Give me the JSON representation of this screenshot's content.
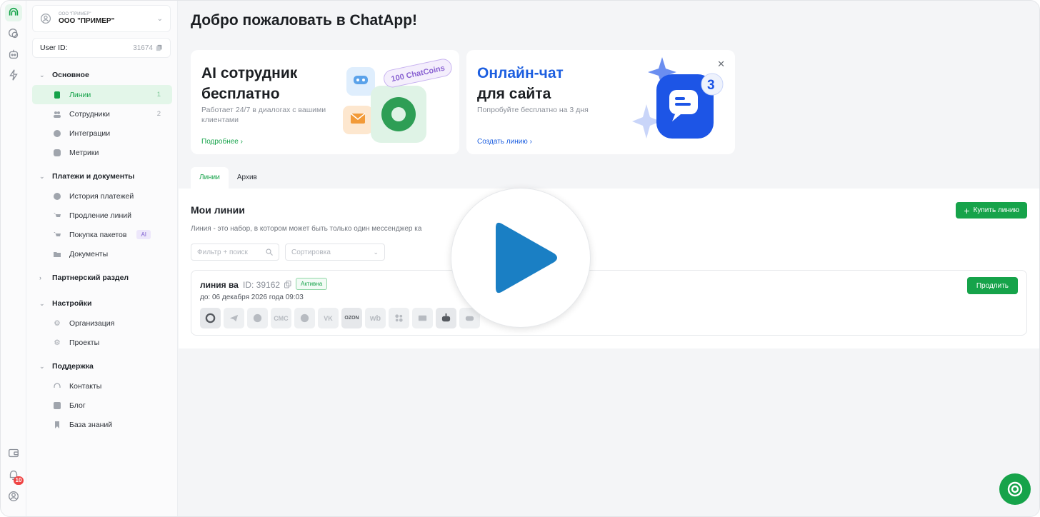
{
  "org": {
    "small_label": "ООО \"ПРИМЕР\"",
    "name": "ООО \"ПРИМЕР\""
  },
  "user": {
    "label": "User ID:",
    "value": "31674"
  },
  "nav": {
    "main": {
      "label": "Основное",
      "items": [
        {
          "label": "Линии",
          "count": "1"
        },
        {
          "label": "Сотрудники",
          "count": "2"
        },
        {
          "label": "Интеграции"
        },
        {
          "label": "Метрики"
        }
      ]
    },
    "payments": {
      "label": "Платежи и документы",
      "items": [
        {
          "label": "История платежей"
        },
        {
          "label": "Продление линий"
        },
        {
          "label": "Покупка пакетов",
          "chip": "AI"
        },
        {
          "label": "Документы"
        }
      ]
    },
    "partner": {
      "label": "Партнерский раздел"
    },
    "settings": {
      "label": "Настройки",
      "items": [
        {
          "label": "Организация"
        },
        {
          "label": "Проекты"
        }
      ]
    },
    "support": {
      "label": "Поддержка",
      "items": [
        {
          "label": "Контакты"
        },
        {
          "label": "Блог"
        },
        {
          "label": "База знаний"
        }
      ]
    }
  },
  "rail": {
    "notification_count": "10"
  },
  "page": {
    "title": "Добро пожаловать в ChatApp!"
  },
  "banners": {
    "ai": {
      "title_line1": "AI сотрудник",
      "title_line2": "бесплатно",
      "desc": "Работает 24/7 в диалогах с вашими клиентами",
      "link": "Подробнее",
      "coins": "100 ChatCoins"
    },
    "chat": {
      "title_line1": "Онлайн-чат",
      "title_line2": "для сайта",
      "desc": "Попробуйте бесплатно на 3 дня",
      "link": "Создать линию",
      "badge": "3"
    }
  },
  "tabs": [
    "Линии",
    "Архив"
  ],
  "lines_panel": {
    "title": "Мои линии",
    "desc": "Линия - это набор, в котором может быть только один мессенджер ка",
    "buy_button": "Купить линию",
    "filter_placeholder": "Фильтр + поиск",
    "sort_placeholder": "Сортировка"
  },
  "line": {
    "name": "линия ва",
    "id": "ID: 39162",
    "status": "Активна",
    "until": "до: 06 декабря 2026 года 09:03",
    "extend_button": "Продлить",
    "messenger_labels": {
      "sms": "СМС",
      "vk": "VK",
      "ozon": "OZON",
      "wb": "wb"
    }
  },
  "colors": {
    "brand_green": "#16a34a",
    "brand_blue": "#1d5fe0",
    "status_bg": "#f2fbf5"
  }
}
